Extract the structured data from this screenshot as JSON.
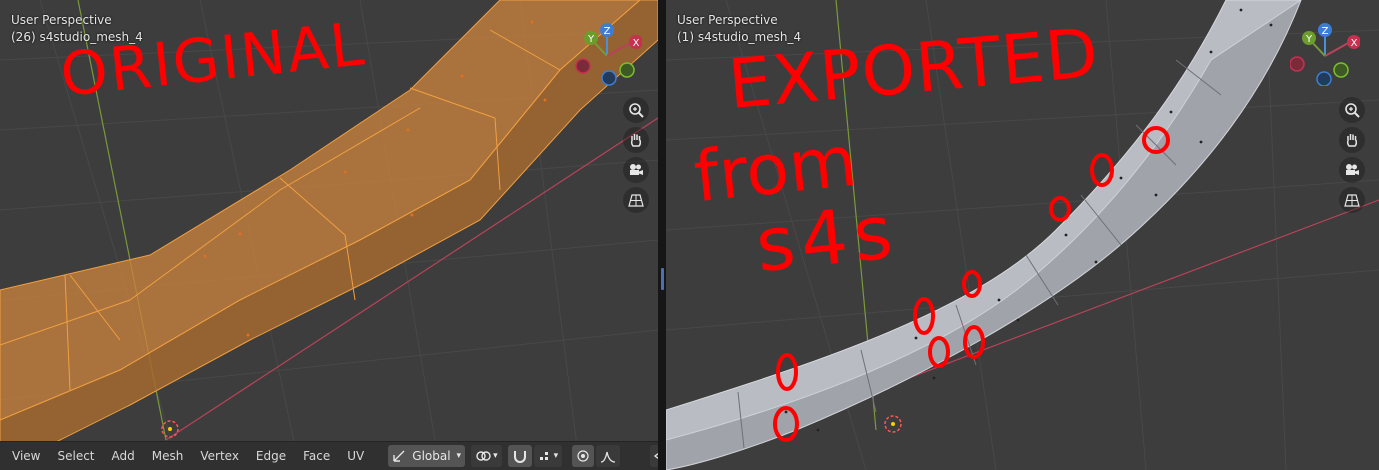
{
  "left_viewport": {
    "title": "User Perspective",
    "object": "(26) s4studio_mesh_4",
    "annotation": "ORIGINAL"
  },
  "right_viewport": {
    "title": "User Perspective",
    "object": "(1) s4studio_mesh_4",
    "annotation_line1": "EXPORTED",
    "annotation_line2": "from",
    "annotation_line3": "s4s"
  },
  "gizmo": {
    "z": "Z",
    "y": "Y",
    "x": "X"
  },
  "header": {
    "menus": [
      "View",
      "Select",
      "Add",
      "Mesh",
      "Vertex",
      "Edge",
      "Face",
      "UV"
    ],
    "orientation": "Global"
  },
  "colors": {
    "viewport_bg": "#3d3d3d",
    "mesh_orange": "#c9813e",
    "mesh_grey": "#b9bcc3",
    "annotation": "#ff0000",
    "axis_x": "#b8435a",
    "axis_y": "#7a9a3a"
  },
  "icons": {
    "nav": [
      "zoom-icon",
      "hand-pan-icon",
      "camera-icon",
      "grid-icon"
    ]
  }
}
